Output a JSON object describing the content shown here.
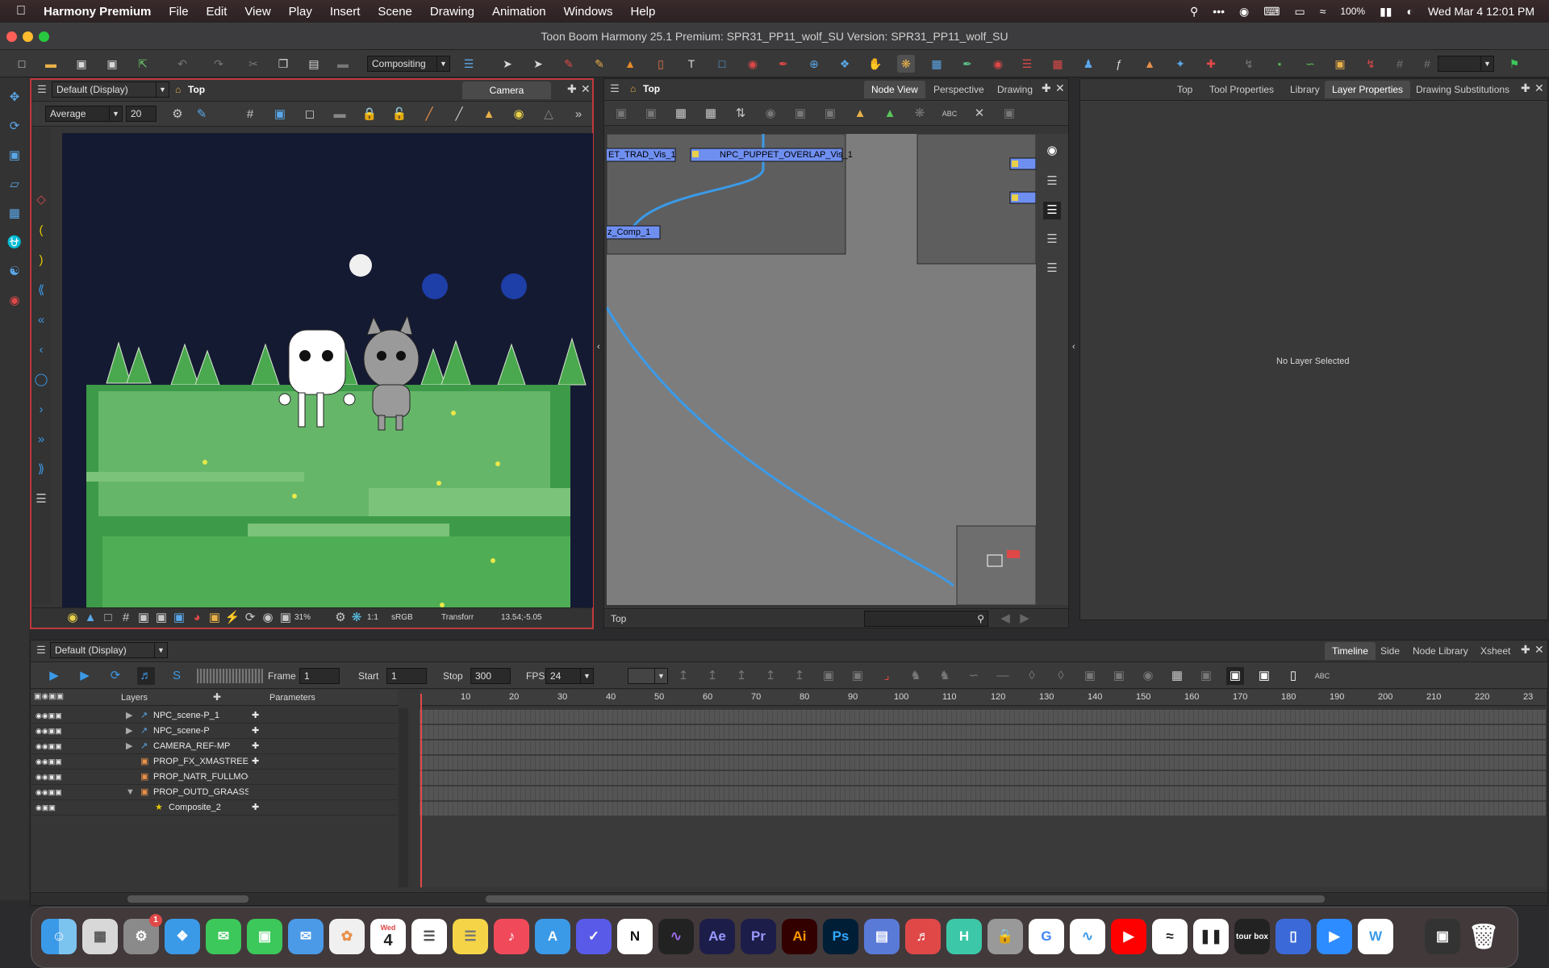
{
  "menubar": {
    "app_name": "Harmony Premium",
    "items": [
      "File",
      "Edit",
      "View",
      "Play",
      "Insert",
      "Scene",
      "Drawing",
      "Animation",
      "Windows",
      "Help"
    ],
    "battery": "100%",
    "datetime": "Wed Mar 4  12:01 PM"
  },
  "window": {
    "title": "Toon Boom Harmony 25.1 Premium: SPR31_PP11_wolf_SU Version: SPR31_PP11_wolf_SU"
  },
  "toolbar": {
    "workspace": "Compositing"
  },
  "camera_view": {
    "display": "Default (Display)",
    "breadcrumb": "Top",
    "tab": "Camera",
    "filter": "Average",
    "filter_value": "20",
    "zoom": "31%",
    "ratio": "1:1",
    "color_space": "sRGB",
    "tool": "Transforr",
    "coords": "13.54;-5.05"
  },
  "node_view": {
    "breadcrumb": "Top",
    "tabs": [
      "Node View",
      "Perspective",
      "Drawing"
    ],
    "active_tab": "Node View",
    "nodes": [
      "ET_TRAD_Vis_1",
      "NPC_PUPPET_OVERLAP_Vis_1",
      "z_Comp_1"
    ],
    "footer": "Top"
  },
  "right_panel": {
    "tabs": [
      "Top",
      "Tool Properties",
      "Library",
      "Layer Properties",
      "Drawing Substitutions"
    ],
    "active_tab": "Layer Properties",
    "message": "No Layer Selected"
  },
  "timeline": {
    "display": "Default (Display)",
    "tabs": [
      "Timeline",
      "Side",
      "Node Library",
      "Xsheet"
    ],
    "active_tab": "Timeline",
    "frame_label": "Frame",
    "frame": "1",
    "start_label": "Start",
    "start": "1",
    "stop_label": "Stop",
    "stop": "300",
    "fps_label": "FPS",
    "fps": "24",
    "col_layers": "Layers",
    "col_params": "Parameters",
    "layers": [
      {
        "name": "NPC_scene-P_1",
        "type": "group"
      },
      {
        "name": "NPC_scene-P",
        "type": "group"
      },
      {
        "name": "CAMERA_REF-MP",
        "type": "group"
      },
      {
        "name": "PROP_FX_XMASTREES",
        "type": "drawing"
      },
      {
        "name": "PROP_NATR_FULLMOON_",
        "type": "drawing"
      },
      {
        "name": "PROP_OUTD_GRAASSYKN",
        "type": "drawing"
      },
      {
        "name": "Composite_2",
        "type": "composite"
      }
    ],
    "ruler": [
      "10",
      "20",
      "30",
      "40",
      "50",
      "60",
      "70",
      "80",
      "90",
      "100",
      "110",
      "120",
      "130",
      "140",
      "150",
      "160",
      "170",
      "180",
      "190",
      "200",
      "210",
      "220",
      "23"
    ]
  },
  "dock": {
    "badge": "1",
    "calendar_month": "Wed",
    "calendar_day": "4",
    "apps": [
      "Finder",
      "Launchpad",
      "System Settings",
      "Safari",
      "Messages",
      "FaceTime",
      "Mail",
      "Photos",
      "Calendar",
      "Reminders",
      "Notes",
      "Music",
      "App Store",
      "OmniFocus",
      "Notion",
      "Activity",
      "After Effects",
      "Premiere Pro",
      "Illustrator",
      "Photoshop",
      "Harmony",
      "Scrivener",
      "Hype",
      "Keychain",
      "Chrome",
      "Grapher",
      "YouTube",
      "Perplexity",
      "Pause",
      "TourBox",
      "Simulator",
      "Zoom",
      "Wunder",
      "Photo Booth",
      "Trash"
    ],
    "labels": {
      "ae": "Ae",
      "pr": "Pr",
      "ai": "Ai",
      "ps": "Ps",
      "h": "H",
      "g": "G",
      "w": "W",
      "tour": "tour box"
    }
  },
  "colors": {
    "accent_blue": "#3b7ddd",
    "node_blue": "#6f8ff0",
    "grass": "#4aa84e",
    "sky": "#151a33"
  }
}
